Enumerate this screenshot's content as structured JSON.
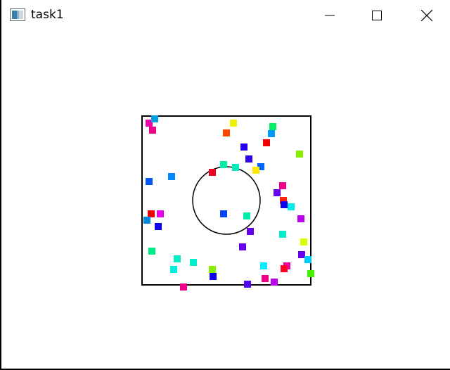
{
  "window": {
    "title": "task1",
    "icon": "window-app-icon",
    "controls": {
      "minimize": "minimize-icon",
      "maximize": "maximize-icon",
      "close": "close-icon"
    }
  },
  "scene": {
    "box_color": "#000000",
    "circle_color": "#000000",
    "particles": [
      {
        "c": "#ee00aa"
      },
      {
        "c": "#00a0e0"
      },
      {
        "c": "#ee0088"
      },
      {
        "c": "#f0f000"
      },
      {
        "c": "#00ee66"
      },
      {
        "c": "#ff4400"
      },
      {
        "c": "#0099ff"
      },
      {
        "c": "#ee0000"
      },
      {
        "c": "#2200ee"
      },
      {
        "c": "#88ee00"
      },
      {
        "c": "#3300ee"
      },
      {
        "c": "#00eeaa"
      },
      {
        "c": "#00eebb"
      },
      {
        "c": "#0066ff"
      },
      {
        "c": "#ffe800"
      },
      {
        "c": "#ee0022"
      },
      {
        "c": "#0088ff"
      },
      {
        "c": "#0055ff"
      },
      {
        "c": "#ee0088"
      },
      {
        "c": "#6600ee"
      },
      {
        "c": "#ff2200"
      },
      {
        "c": "#1100ee"
      },
      {
        "c": "#00eeee"
      },
      {
        "c": "#ee0000"
      },
      {
        "c": "#ee00ee"
      },
      {
        "c": "#0044ff"
      },
      {
        "c": "#00eeaa"
      },
      {
        "c": "#0088dd"
      },
      {
        "c": "#1100ee"
      },
      {
        "c": "#bb00ee"
      },
      {
        "c": "#6600ee"
      },
      {
        "c": "#00eecc"
      },
      {
        "c": "#ddff00"
      },
      {
        "c": "#6600ee"
      },
      {
        "c": "#00ee88"
      },
      {
        "c": "#6600ee"
      },
      {
        "c": "#00ccff"
      },
      {
        "c": "#00eecc"
      },
      {
        "c": "#00eecc"
      },
      {
        "c": "#00eedd"
      },
      {
        "c": "#ee00aa"
      },
      {
        "c": "#ff0022"
      },
      {
        "c": "#88ee00"
      },
      {
        "c": "#1100ee"
      },
      {
        "c": "#44ee00"
      },
      {
        "c": "#ee0088"
      },
      {
        "c": "#bb00ee"
      },
      {
        "c": "#5500ee"
      },
      {
        "c": "#ee0088"
      },
      {
        "c": "#00eeff"
      }
    ]
  }
}
